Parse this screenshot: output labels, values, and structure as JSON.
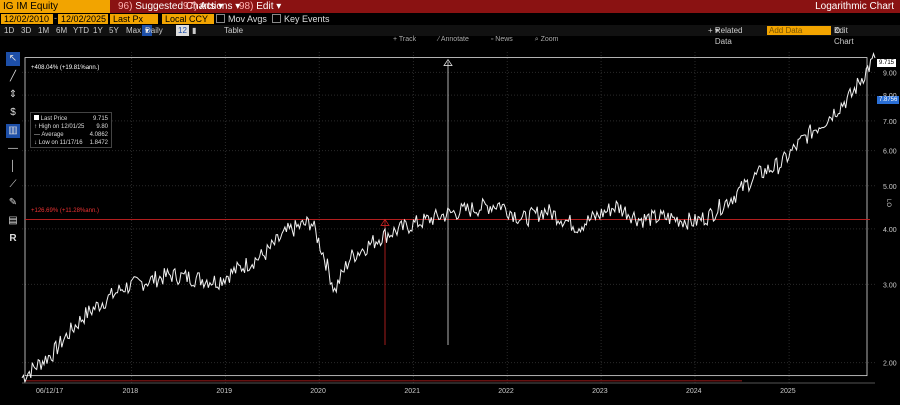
{
  "header": {
    "ticker": "IG IM Equity",
    "menus": [
      {
        "num": "96)",
        "label": "Suggested Charts"
      },
      {
        "num": "97)",
        "label": "Actions"
      },
      {
        "num": "98)",
        "label": "Edit"
      }
    ],
    "title": "Logarithmic Chart"
  },
  "controls": {
    "start_date": "12/02/2010",
    "end_date": "12/02/2025",
    "price_field": "Last Px",
    "currency": "Local CCY",
    "mov_avgs": "Mov Avgs",
    "key_events": "Key Events"
  },
  "periods": [
    "1D",
    "3D",
    "1M",
    "6M",
    "YTD",
    "1Y",
    "5Y",
    "Max"
  ],
  "frequency": "Daily",
  "freq_value": "12",
  "table_label": "Table",
  "related_data": "Related Data",
  "add_data_placeholder": "Add Data",
  "edit_chart": "Edit Chart",
  "chart_toolbar": [
    "Track",
    "Annotate",
    "News",
    "Zoom"
  ],
  "legend": {
    "last_price_label": "Last Price",
    "last_price": "9.715",
    "high_label": "High on 12/01/25",
    "high": "9.80",
    "avg_label": "Average",
    "avg": "4.0862",
    "low_label": "Low on 11/17/16",
    "low": "1.8472"
  },
  "annotations": {
    "top_line": "+408.04% (+19.81%ann.)",
    "mid_line": "+126.69% (+11.28%ann.)"
  },
  "price_tags": {
    "last": "9.715",
    "marker": "7.8756"
  },
  "axis": {
    "y_ticks": [
      "9.00",
      "8.00",
      "7.00",
      "6.00",
      "5.00",
      "4.00",
      "3.00",
      "2.00"
    ],
    "x_ticks": [
      "2018",
      "2019",
      "2020",
      "2021",
      "2022",
      "2023",
      "2024",
      "2025"
    ],
    "x_start": "06/12/17",
    "lo_label": "LO"
  },
  "chart_data": {
    "type": "line",
    "yscale": "log",
    "ylim": [
      1.8,
      10
    ],
    "x": [
      "2016-11",
      "2017-03",
      "2017-07",
      "2017-12",
      "2018-06",
      "2018-12",
      "2019-06",
      "2019-09",
      "2019-12",
      "2020-03",
      "2020-05",
      "2020-09",
      "2021-01",
      "2021-06",
      "2021-12",
      "2022-03",
      "2022-06",
      "2022-10",
      "2023-03",
      "2023-06",
      "2023-09",
      "2024-01",
      "2024-03",
      "2024-06",
      "2024-09",
      "2024-12",
      "2025-03",
      "2025-06",
      "2025-09",
      "2025-12"
    ],
    "series": [
      {
        "values": [
          1.85,
          2.1,
          2.55,
          2.95,
          3.15,
          3.05,
          3.5,
          3.95,
          4.15,
          2.9,
          3.45,
          3.85,
          4.1,
          4.35,
          4.55,
          4.2,
          4.4,
          4.05,
          4.5,
          4.2,
          4.25,
          4.15,
          4.3,
          4.75,
          5.3,
          5.6,
          6.4,
          7.1,
          8.0,
          9.7
        ]
      }
    ],
    "reference_lines": [
      9.715,
      4.2,
      1.87
    ]
  }
}
